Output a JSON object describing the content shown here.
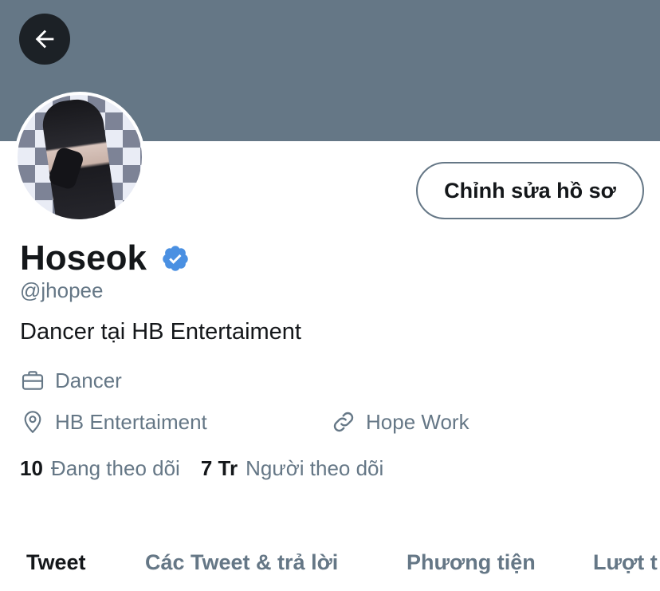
{
  "header": {
    "back_icon": "arrow-left-icon"
  },
  "profile": {
    "avatar_icon": "profile-avatar",
    "edit_button_label": "Chỉnh sửa hồ sơ",
    "name": "Hoseok",
    "verified_icon": "verified-badge-icon",
    "verified_color": "#4A90E2",
    "handle": "@jhopee",
    "bio": "Dancer tại HB Entertaiment",
    "job": "Dancer",
    "job_icon": "briefcase-icon",
    "location": "HB Entertaiment",
    "location_icon": "location-pin-icon",
    "website": "Hope Work",
    "website_icon": "link-icon"
  },
  "stats": {
    "following_count": "10",
    "following_label": "Đang theo dõi",
    "followers_count": "7 Tr",
    "followers_label": "Người theo dõi"
  },
  "tabs": [
    {
      "label": "Tweet",
      "active": true
    },
    {
      "label": "Các Tweet & trả lời",
      "active": false
    },
    {
      "label": "Phương tiện",
      "active": false
    },
    {
      "label": "Lượt t",
      "active": false
    }
  ],
  "colors": {
    "banner": "#657786",
    "text_primary": "#14171a",
    "text_secondary": "#657786",
    "verified": "#4A90E2"
  }
}
